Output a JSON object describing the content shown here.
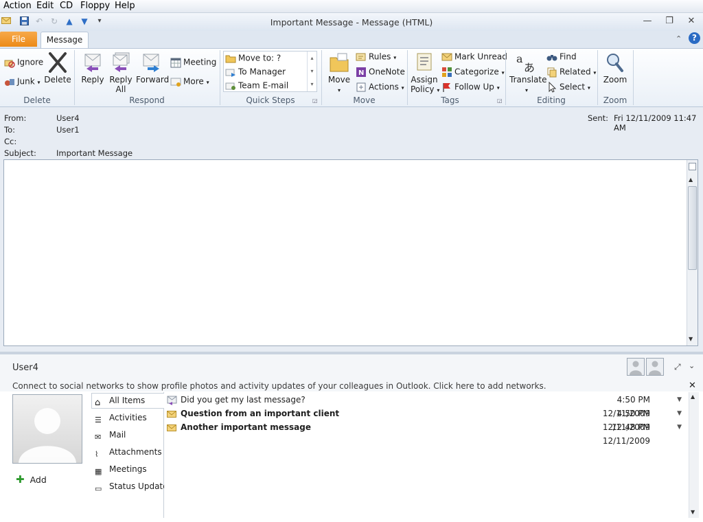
{
  "menubar": {
    "items": [
      "Action",
      "Edit",
      "CD",
      "Floppy",
      "Help"
    ]
  },
  "window": {
    "title": "Important Message  -  Message (HTML)"
  },
  "tabs": {
    "file": "File",
    "message": "Message"
  },
  "ribbon": {
    "delete": {
      "label": "Delete",
      "ignore": "Ignore",
      "junk": "Junk",
      "delete_btn": "Delete"
    },
    "respond": {
      "label": "Respond",
      "reply": "Reply",
      "reply_all_1": "Reply",
      "reply_all_2": "All",
      "forward": "Forward",
      "meeting": "Meeting",
      "more": "More"
    },
    "quick_steps": {
      "label": "Quick Steps",
      "items": [
        "Move to: ?",
        "To Manager",
        "Team E-mail"
      ]
    },
    "move": {
      "label": "Move",
      "move": "Move",
      "rules": "Rules",
      "onenote": "OneNote",
      "actions": "Actions"
    },
    "tags": {
      "label": "Tags",
      "assign_1": "Assign",
      "assign_2": "Policy",
      "mark_unread": "Mark Unread",
      "categorize": "Categorize",
      "follow_up": "Follow Up"
    },
    "editing": {
      "label": "Editing",
      "translate": "Translate",
      "find": "Find",
      "related": "Related",
      "select": "Select"
    },
    "zoom": {
      "label": "Zoom",
      "zoom": "Zoom"
    }
  },
  "header": {
    "from_label": "From:",
    "from": "User4",
    "to_label": "To:",
    "to": "User1",
    "cc_label": "Cc:",
    "subject_label": "Subject:",
    "subject": "Important Message",
    "sent_label": "Sent:",
    "sent": "Fri 12/11/2009 11:47 AM"
  },
  "people_pane": {
    "contact": "User4",
    "notice": "Connect to social networks to show profile photos and activity updates of your colleagues in Outlook. Click here to add networks.",
    "add": "Add",
    "nav": [
      "All Items",
      "Activities",
      "Mail",
      "Attachments",
      "Meetings",
      "Status Updates"
    ],
    "items": [
      {
        "subject": "Did you get my last message?",
        "time": "4:50 PM 12/11/2009",
        "bold": false
      },
      {
        "subject": "Question from an important client",
        "time": "4:50 PM 12/11/2009",
        "bold": true
      },
      {
        "subject": "Another important message",
        "time": "12:48 PM 12/11/2009",
        "bold": true
      }
    ]
  },
  "colors": {
    "file_tab": "#ec8a17",
    "accent": "#1f5aa6"
  }
}
